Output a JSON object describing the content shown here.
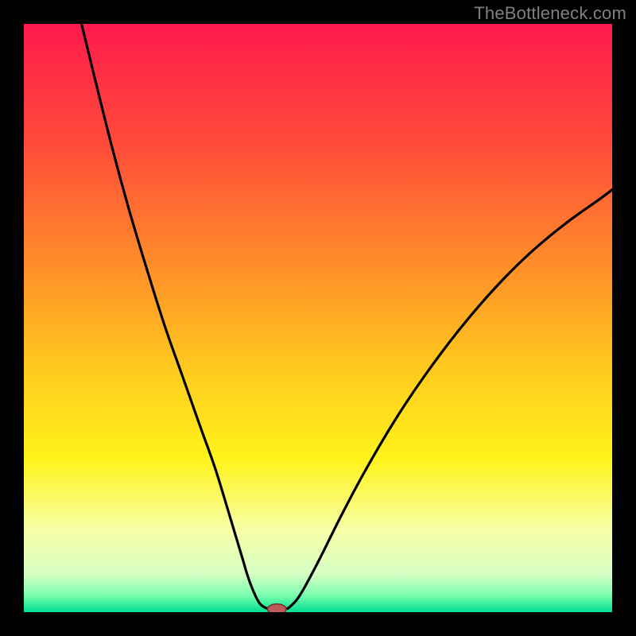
{
  "watermark": "TheBottleneck.com",
  "colors": {
    "frame": "#000000",
    "curve": "#000000",
    "marker_fill": "#c05a5a",
    "marker_stroke": "#6a2a2a",
    "gradient_stops": [
      {
        "offset": 0.0,
        "color": "#ff1a4d"
      },
      {
        "offset": 0.2,
        "color": "#ff4a3a"
      },
      {
        "offset": 0.4,
        "color": "#ff8a2a"
      },
      {
        "offset": 0.58,
        "color": "#ffc81f"
      },
      {
        "offset": 0.74,
        "color": "#fff31a"
      },
      {
        "offset": 0.86,
        "color": "#f7ffa6"
      },
      {
        "offset": 0.935,
        "color": "#d6ffc4"
      },
      {
        "offset": 0.97,
        "color": "#7fffb0"
      },
      {
        "offset": 1.0,
        "color": "#00e090"
      }
    ]
  },
  "chart_data": {
    "type": "line",
    "title": "",
    "xlabel": "",
    "ylabel": "",
    "xlim": [
      0,
      100
    ],
    "ylim": [
      0,
      100
    ],
    "grid": false,
    "legend": false,
    "series": [
      {
        "name": "curve",
        "x": [
          9.8,
          12,
          15,
          18,
          21,
          24,
          27,
          30,
          32.5,
          34.5,
          36,
          37.2,
          38,
          39,
          40,
          40.8,
          41.7,
          44.3,
          45.2,
          47,
          50,
          54,
          58,
          63,
          68,
          74,
          80,
          86,
          92,
          98,
          100
        ],
        "y": [
          100,
          91,
          79,
          68,
          58,
          48.5,
          40,
          31.5,
          24.5,
          18,
          13,
          9,
          6.3,
          3.6,
          1.6,
          0.9,
          0.6,
          0.6,
          0.9,
          3,
          8.5,
          16.5,
          24,
          32.5,
          40,
          48,
          55,
          61,
          66,
          70.3,
          71.8
        ]
      }
    ],
    "marker": {
      "x": 43,
      "y": 0.5,
      "rx": 1.6,
      "ry": 0.9
    }
  }
}
